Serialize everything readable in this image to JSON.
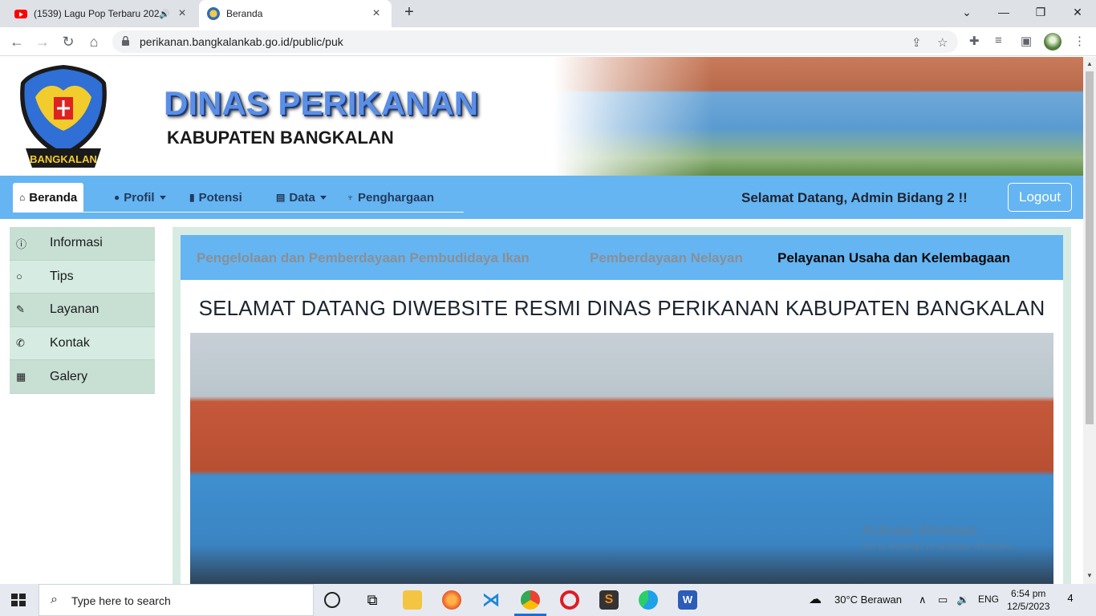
{
  "browser": {
    "tabs": [
      {
        "title": "(1539) Lagu Pop Terbaru 202",
        "icon": "youtube-icon",
        "audio": true
      },
      {
        "title": "Beranda",
        "icon": "site-favicon",
        "active": true
      }
    ],
    "url": "perikanan.bangkalankab.go.id/public/puk"
  },
  "header": {
    "logo_text": "BANGKALAN",
    "title_line1": "DINAS PERIKANAN",
    "title_line2": "KABUPATEN BANGKALAN"
  },
  "navbar": {
    "items": [
      {
        "label": "Beranda",
        "icon": "home-icon"
      },
      {
        "label": "Profil",
        "icon": "user-icon"
      },
      {
        "label": "Potensi",
        "icon": "bookmark-icon"
      },
      {
        "label": "Data",
        "icon": "database-icon"
      },
      {
        "label": "Penghargaan",
        "icon": "trophy-icon"
      }
    ],
    "welcome": "Selamat Datang, Admin Bidang 2 !!",
    "logout": "Logout"
  },
  "sidebar": {
    "items": [
      {
        "label": "Informasi",
        "icon": "info-icon"
      },
      {
        "label": "Tips",
        "icon": "lightbulb-icon"
      },
      {
        "label": "Layanan",
        "icon": "edit-icon"
      },
      {
        "label": "Kontak",
        "icon": "phone-icon"
      },
      {
        "label": "Galery",
        "icon": "gallery-icon"
      }
    ]
  },
  "subnav": {
    "items": [
      {
        "label": "Pengelolaan dan Pemberdayaan Pembudidaya Ikan"
      },
      {
        "label": "Pemberdayaan Nelayan"
      },
      {
        "label": "Pelayanan Usaha dan Kelembagaan",
        "active": true
      }
    ]
  },
  "main": {
    "title": "SELAMAT DATANG DIWEBSITE RESMI DINAS PERIKANAN KABUPATEN BANGKALAN"
  },
  "watermark": {
    "line1": "Activate Windows",
    "line2": "Go to Settings to activate Windows."
  },
  "taskbar": {
    "search_placeholder": "Type here to search",
    "weather": "30°C  Berawan",
    "lang": "ENG",
    "time": "6:54 pm",
    "date": "12/5/2023",
    "notifications": "4"
  }
}
